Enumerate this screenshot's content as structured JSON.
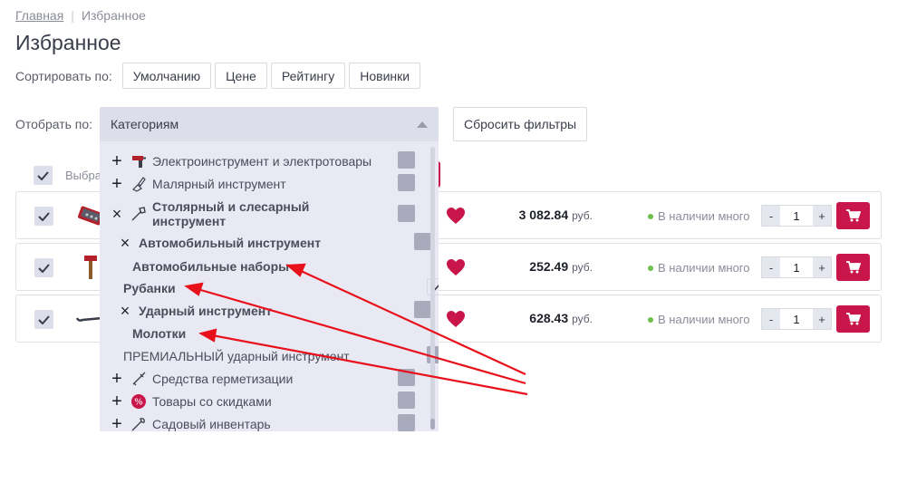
{
  "breadcrumb": {
    "home": "Главная",
    "current": "Избранное"
  },
  "page_title": "Избранное",
  "sort": {
    "label": "Сортировать по:",
    "options": [
      "Умолчанию",
      "Цене",
      "Рейтингу",
      "Новинки"
    ]
  },
  "filter": {
    "label": "Отобрать по:",
    "selected": "Категориям",
    "reset_label": "Сбросить фильтры"
  },
  "select_all_label": "Выбра",
  "categories": [
    {
      "label": "Электроинструмент и электротовары",
      "marker": "+",
      "checked": false
    },
    {
      "label": "Малярный инструмент",
      "marker": "+",
      "checked": false
    },
    {
      "label": "Столярный и слесарный инструмент",
      "marker": "×",
      "checked": false
    },
    {
      "label": "Автомобильный инструмент",
      "marker": "×",
      "checked": false
    },
    {
      "label": "Автомобильные наборы",
      "marker": "",
      "checked": true
    },
    {
      "label": "Рубанки",
      "marker": "",
      "checked": true
    },
    {
      "label": "Ударный инструмент",
      "marker": "×",
      "checked": false
    },
    {
      "label": "Молотки",
      "marker": "",
      "checked": true
    },
    {
      "label": "ПРЕМИАЛЬНЫЙ ударный инструмент",
      "marker": "",
      "checked": false
    },
    {
      "label": "Средства герметизации",
      "marker": "+",
      "checked": false
    },
    {
      "label": "Товары со скидками",
      "marker": "+",
      "checked": false
    },
    {
      "label": "Садовый инвентарь",
      "marker": "+",
      "checked": false
    }
  ],
  "products": [
    {
      "price": "3 082.84",
      "currency": "руб.",
      "stock": "В наличии много",
      "qty": "1",
      "thumb": "toolkit-icon"
    },
    {
      "price": "252.49",
      "currency": "руб.",
      "stock": "В наличии много",
      "qty": "1",
      "thumb": "hammer-icon"
    },
    {
      "price": "628.43",
      "currency": "руб.",
      "stock": "В наличии много",
      "qty": "1",
      "thumb": "crowbar-icon"
    }
  ],
  "qty_minus": "-",
  "qty_plus": "+",
  "colors": {
    "accent": "#c8164a",
    "select_bg": "#dcdeea",
    "dropdown_bg": "#e8e9f3",
    "stock_dot": "#6cc04a",
    "arrow": "#e8101a"
  }
}
